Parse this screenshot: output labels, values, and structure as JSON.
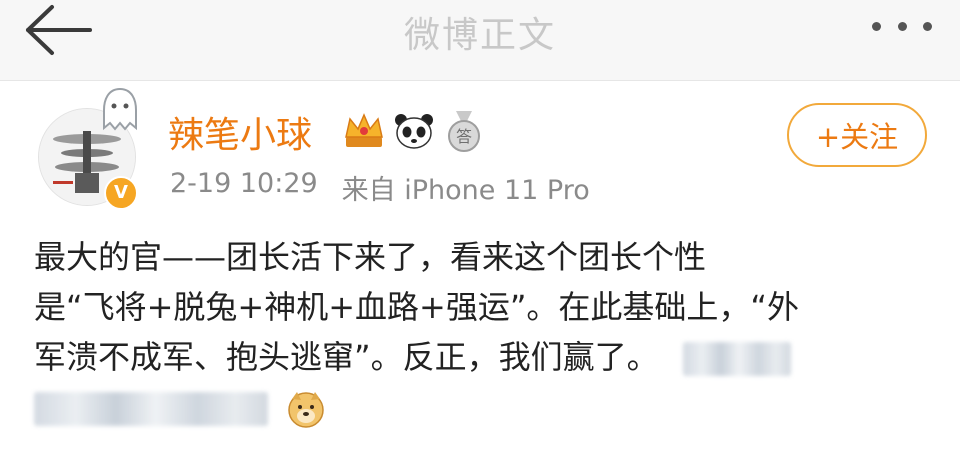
{
  "topbar": {
    "title": "微博正文",
    "back_icon": "arrow-left-icon",
    "more_icon": "more-dots-icon"
  },
  "post": {
    "author": {
      "name": "辣笔小球",
      "avatar_icon": "avatar",
      "decoration_icon": "ghost-icon",
      "verified_badge": "V",
      "badges": [
        "crown-icon",
        "panda-icon",
        "medal-icon"
      ],
      "badge_medal_text": "答"
    },
    "time": "2-19 10:29",
    "source": "来自 iPhone 11 Pro",
    "follow_label": "+关注",
    "text_lines": [
      "最大的官——团长活下来了，看来这个团长个性",
      "是“飞将+脱兔+神机+血路+强运”。在此基础上，“外",
      "军溃不成军、抱头逃窜”。反正，我们赢了。"
    ],
    "emoji_icon": "doge-icon"
  },
  "colors": {
    "accent": "#ec7a12",
    "follow_border": "#f2a93b",
    "meta": "#8a8a8a",
    "title": "#c8c8c8"
  }
}
